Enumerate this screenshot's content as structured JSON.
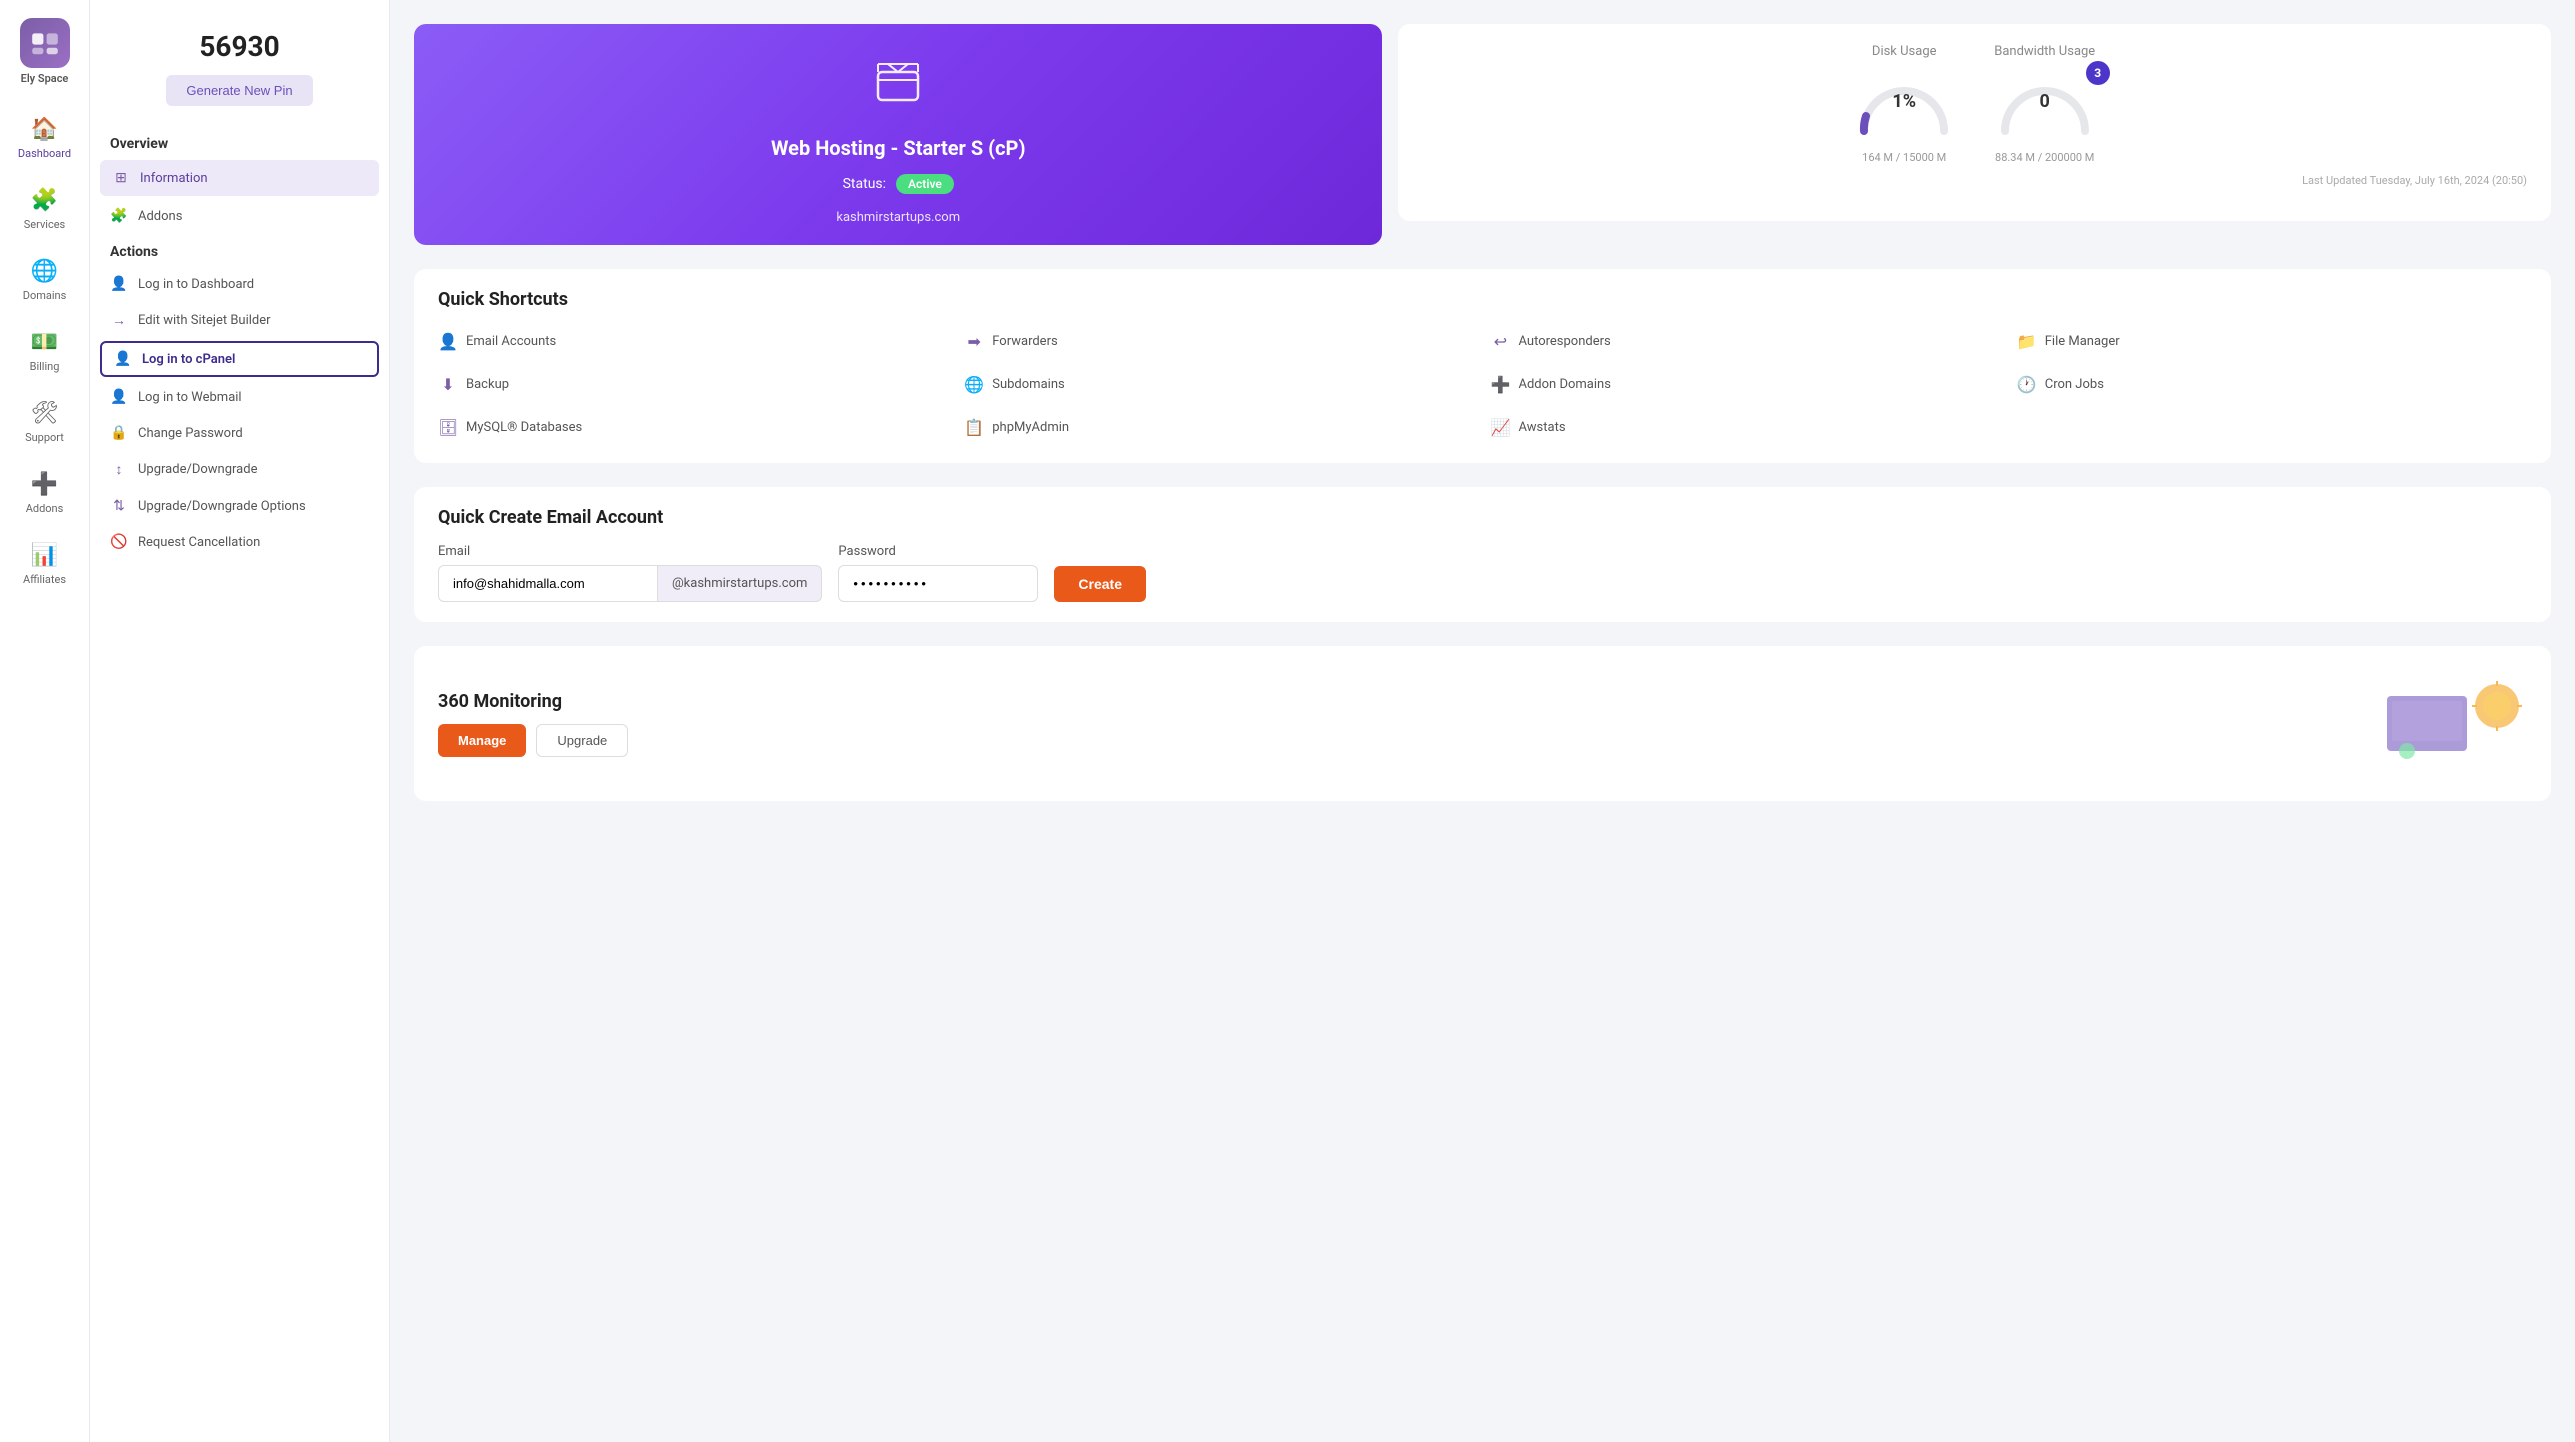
{
  "sidebar": {
    "logo": {
      "text": "Ely Space"
    },
    "items": [
      {
        "id": "dashboard",
        "label": "Dashboard",
        "icon": "🏠"
      },
      {
        "id": "services",
        "label": "Services",
        "icon": "🧩"
      },
      {
        "id": "domains",
        "label": "Domains",
        "icon": "🌐"
      },
      {
        "id": "billing",
        "label": "Billing",
        "icon": "💵"
      },
      {
        "id": "support",
        "label": "Support",
        "icon": "🛠"
      },
      {
        "id": "addons",
        "label": "Addons",
        "icon": "➕"
      },
      {
        "id": "affiliates",
        "label": "Affiliates",
        "icon": "📊"
      }
    ]
  },
  "left_panel": {
    "pin": "56930",
    "generate_pin_label": "Generate New Pin",
    "overview_title": "Overview",
    "actions_title": "Actions",
    "overview_items": [
      {
        "id": "information",
        "label": "Information",
        "icon": "⊞"
      },
      {
        "id": "addons",
        "label": "Addons",
        "icon": "🧩"
      }
    ],
    "action_items": [
      {
        "id": "login-dashboard",
        "label": "Log in to Dashboard",
        "icon": "👤"
      },
      {
        "id": "edit-sitejet",
        "label": "Edit with Sitejet Builder",
        "icon": "→"
      },
      {
        "id": "login-cpanel",
        "label": "Log in to cPanel",
        "icon": "👤",
        "highlighted": true
      },
      {
        "id": "login-webmail",
        "label": "Log in to Webmail",
        "icon": "👤"
      },
      {
        "id": "change-password",
        "label": "Change Password",
        "icon": "🔒"
      },
      {
        "id": "upgrade-downgrade",
        "label": "Upgrade/Downgrade",
        "icon": "↕"
      },
      {
        "id": "upgrade-downgrade-options",
        "label": "Upgrade/Downgrade Options",
        "icon": "⇅"
      },
      {
        "id": "request-cancellation",
        "label": "Request Cancellation",
        "icon": "🚫"
      }
    ]
  },
  "service": {
    "title": "Web Hosting - Starter S (cP)",
    "status": "Active",
    "status_label": "Status:",
    "domain": "kashmirstartups.com"
  },
  "stats": {
    "disk_usage_title": "Disk Usage",
    "bandwidth_title": "Bandwidth Usage",
    "disk_percent": "1%",
    "disk_used": "164 M / 15000 M",
    "bandwidth_value": "0",
    "bandwidth_used": "88.34 M / 200000 M",
    "notification_count": "3",
    "last_updated": "Last Updated Tuesday, July 16th, 2024 (20:50)"
  },
  "shortcuts": {
    "title": "Quick Shortcuts",
    "items": [
      {
        "id": "email-accounts",
        "label": "Email Accounts",
        "icon": "👤"
      },
      {
        "id": "forwarders",
        "label": "Forwarders",
        "icon": "➡"
      },
      {
        "id": "autoresponders",
        "label": "Autoresponders",
        "icon": "↩"
      },
      {
        "id": "file-manager",
        "label": "File Manager",
        "icon": "📁"
      },
      {
        "id": "backup",
        "label": "Backup",
        "icon": "⬇"
      },
      {
        "id": "subdomains",
        "label": "Subdomains",
        "icon": "🌐"
      },
      {
        "id": "addon-domains",
        "label": "Addon Domains",
        "icon": "➕"
      },
      {
        "id": "cron-jobs",
        "label": "Cron Jobs",
        "icon": "🕐"
      },
      {
        "id": "mysql-databases",
        "label": "MySQL® Databases",
        "icon": "🗄"
      },
      {
        "id": "phpmyadmin",
        "label": "phpMyAdmin",
        "icon": "📋"
      },
      {
        "id": "awstats",
        "label": "Awstats",
        "icon": "📈"
      }
    ]
  },
  "quick_create": {
    "title": "Quick Create Email Account",
    "email_label": "Email",
    "email_value": "info@shahidmalla.com",
    "email_local": "info@shahidmalla.com",
    "email_domain": "@kashmirstartups.com",
    "password_label": "Password",
    "password_value": "••••••••••",
    "create_label": "Create"
  },
  "monitoring": {
    "title": "360 Monitoring",
    "manage_label": "Manage",
    "upgrade_label": "Upgrade"
  }
}
